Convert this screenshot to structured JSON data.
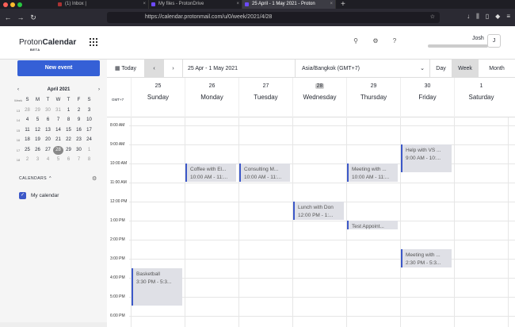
{
  "browser": {
    "tabs": [
      {
        "label": "(1) Inbox |"
      },
      {
        "label": "My files - ProtonDrive"
      },
      {
        "label": "25 April - 1 May 2021 - Proton"
      }
    ],
    "url": "https://calendar.protonmail.com/u/0/week/2021/4/28"
  },
  "app": {
    "name_a": "Proton",
    "name_b": "Calendar",
    "beta": "BETA"
  },
  "user": {
    "name": "Josh",
    "initial": "J"
  },
  "sidebar": {
    "new_event": "New event",
    "month_title": "April 2021",
    "week_label": "Week",
    "weekday_initials": [
      "S",
      "M",
      "T",
      "W",
      "T",
      "F",
      "S"
    ],
    "weeks": [
      {
        "wk": "13",
        "days": [
          "28",
          "29",
          "30",
          "31",
          "1",
          "2",
          "3"
        ]
      },
      {
        "wk": "14",
        "days": [
          "4",
          "5",
          "6",
          "7",
          "8",
          "9",
          "10"
        ]
      },
      {
        "wk": "15",
        "days": [
          "11",
          "12",
          "13",
          "14",
          "15",
          "16",
          "17"
        ]
      },
      {
        "wk": "16",
        "days": [
          "18",
          "19",
          "20",
          "21",
          "22",
          "23",
          "24"
        ]
      },
      {
        "wk": "17",
        "days": [
          "25",
          "26",
          "27",
          "28",
          "29",
          "30",
          "1"
        ]
      },
      {
        "wk": "18",
        "days": [
          "2",
          "3",
          "4",
          "5",
          "6",
          "7",
          "8"
        ]
      }
    ],
    "calendars_label": "CALENDARS",
    "calendar_name": "My calendar"
  },
  "toolbar": {
    "today": "Today",
    "range": "25 Apr - 1 May 2021",
    "timezone": "Asia/Bangkok (GMT+7)",
    "views": [
      "Day",
      "Week",
      "Month"
    ],
    "selected_view": "Week"
  },
  "week": {
    "tz_label": "GMT+7",
    "days": [
      {
        "num": "25",
        "name": "Sunday"
      },
      {
        "num": "26",
        "name": "Monday"
      },
      {
        "num": "27",
        "name": "Tuesday"
      },
      {
        "num": "28",
        "name": "Wednesday",
        "today": true
      },
      {
        "num": "29",
        "name": "Thursday"
      },
      {
        "num": "30",
        "name": "Friday"
      },
      {
        "num": "1",
        "name": "Saturday"
      }
    ],
    "hours": [
      "8:00 AM",
      "9:00 AM",
      "10:00 AM",
      "11:00 AM",
      "12:00 PM",
      "1:00 PM",
      "2:00 PM",
      "3:00 PM",
      "4:00 PM",
      "5:00 PM",
      "6:00 PM"
    ]
  },
  "events": [
    {
      "title": "Coffee with El...",
      "time": "10:00 AM - 11:...",
      "day": 1,
      "start": 10.0,
      "end": 11.0
    },
    {
      "title": "Consulting M...",
      "time": "10:00 AM - 11:...",
      "day": 2,
      "start": 10.0,
      "end": 11.0
    },
    {
      "title": "Meeting with ...",
      "time": "10:00 AM - 11:...",
      "day": 4,
      "start": 10.0,
      "end": 11.0
    },
    {
      "title": "Help with VS ...",
      "time": "9:00 AM - 10:...",
      "day": 5,
      "start": 9.0,
      "end": 10.5
    },
    {
      "title": "Lunch with Don",
      "time": "12:00 PM - 1:...",
      "day": 3,
      "start": 12.0,
      "end": 13.0
    },
    {
      "title": "Test Appoint...",
      "time": "",
      "day": 4,
      "start": 13.0,
      "end": 13.5
    },
    {
      "title": "Meeting with ...",
      "time": "2:30 PM - 5:3...",
      "day": 5,
      "start": 14.5,
      "end": 15.5
    },
    {
      "title": "Basketball",
      "time": "3:30 PM - 5:3...",
      "day": 0,
      "start": 15.5,
      "end": 17.5
    }
  ]
}
